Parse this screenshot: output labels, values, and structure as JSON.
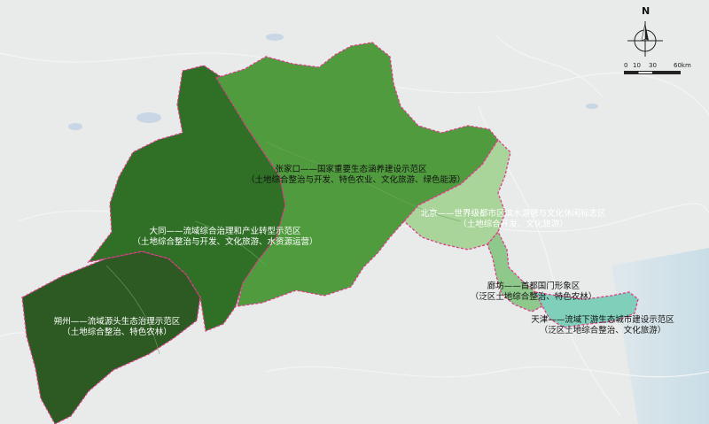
{
  "legend": {
    "north": "N",
    "scale_ticks": [
      "0",
      "10",
      "30",
      "60km"
    ]
  },
  "regions": [
    {
      "id": "zhangjiakou",
      "name": "张家口——国家重要生态涵养建设示范区",
      "detail": "（土地综合整治与开发、特色农业、文化旅游、绿色能源）",
      "color": "#4f9b3e"
    },
    {
      "id": "datong",
      "name": "大同——流域综合治理和产业转型示范区",
      "detail": "（土地综合整治与开发、文化旅游、水资源运营）",
      "color": "#2f6f26"
    },
    {
      "id": "beijing",
      "name": "北京——世界级都市区滨水游憩与文化休闲标志区",
      "detail": "（土地综合开发、文化旅游）",
      "color": "#a9d49a"
    },
    {
      "id": "langfang",
      "name": "廊坊——首都国门形象区",
      "detail": "（泛区土地综合整治、特色农林）",
      "color": "#8ec88a"
    },
    {
      "id": "tianjin",
      "name": "天津——流域下游生态城市建设示范区",
      "detail": "（泛区土地综合整治、文化旅游）",
      "color": "#7fcfba"
    },
    {
      "id": "shuozhou",
      "name": "朔州——流域源头生态治理示范区",
      "detail": "（土地综合整治、特色农林）",
      "color": "#2c5a22"
    }
  ]
}
